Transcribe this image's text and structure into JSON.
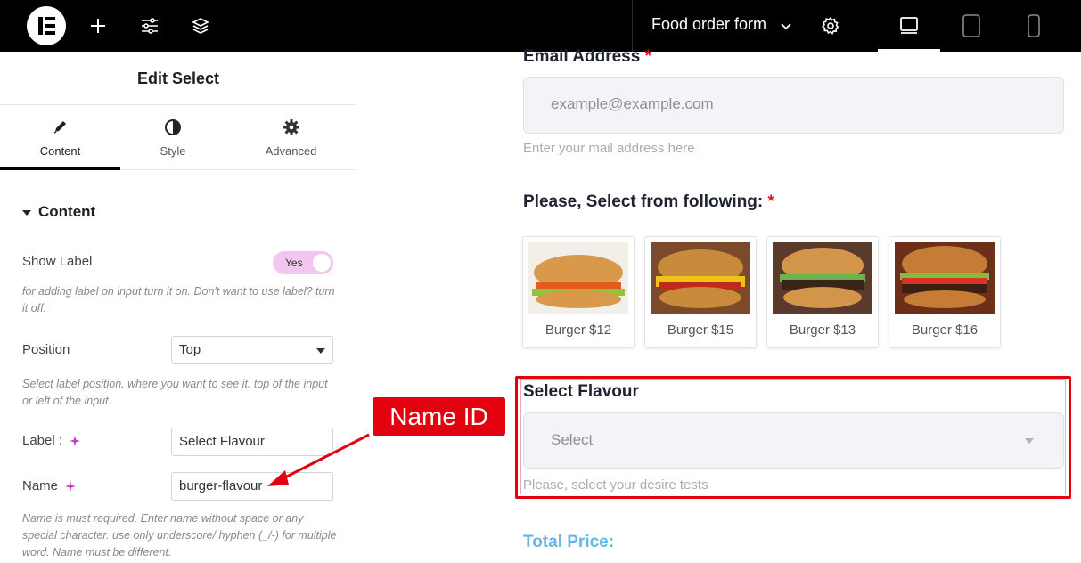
{
  "topbar": {
    "logo": "elementor-logo",
    "icons": [
      "plus-icon",
      "sliders-icon",
      "layers-icon"
    ],
    "document_title": "Food order form",
    "settings_icon": "gear-icon",
    "devices": [
      "desktop-icon",
      "tablet-icon",
      "mobile-icon"
    ],
    "active_device": "desktop"
  },
  "panel": {
    "title": "Edit Select",
    "tabs": [
      {
        "label": "Content",
        "icon": "pencil-icon",
        "active": true
      },
      {
        "label": "Style",
        "icon": "contrast-icon",
        "active": false
      },
      {
        "label": "Advanced",
        "icon": "gear-icon",
        "active": false
      }
    ],
    "section_title": "Content",
    "show_label": {
      "label": "Show Label",
      "toggle_text": "Yes",
      "value": true
    },
    "show_label_help": "for adding label on input turn it on. Don't want to use label? turn it off.",
    "position": {
      "label": "Position",
      "value": "Top"
    },
    "position_help": "Select label position. where you want to see it. top of the input or left of the input.",
    "label_field": {
      "label": "Label :",
      "value": "Select Flavour"
    },
    "name_field": {
      "label": "Name",
      "value": "burger-flavour"
    },
    "name_help": "Name is must required. Enter name without space or any special character. use only underscore/ hyphen (_/-) for multiple word. Name must be different."
  },
  "form": {
    "email_label": "Email Address",
    "required_mark": "*",
    "email_placeholder": "example@example.com",
    "email_description": "Enter your mail address here",
    "choice_label": "Please, Select from following:",
    "choices": [
      {
        "caption": "Burger $12"
      },
      {
        "caption": "Burger $15"
      },
      {
        "caption": "Burger $13"
      },
      {
        "caption": "Burger $16"
      }
    ],
    "select_label": "Select Flavour",
    "select_placeholder": "Select",
    "select_description": "Please, select your desire tests",
    "total_label": "Total Price:"
  },
  "annotation": {
    "callout_text": "Name ID",
    "color": "#e3000f"
  },
  "colors": {
    "accent_toggle": "#f3c6f0",
    "required": "#e0141e",
    "total_price": "#66b7e4"
  }
}
